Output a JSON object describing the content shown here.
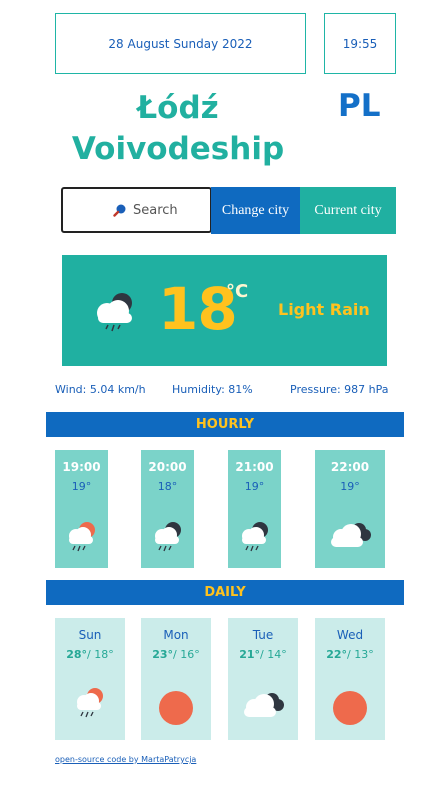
{
  "header": {
    "date": "28 August Sunday 2022",
    "time": "19:55"
  },
  "location": {
    "city_line1": "Łódź",
    "city_line2": "Voivodeship",
    "country": "PL"
  },
  "search": {
    "placeholder": "Search",
    "change_label": "Change city",
    "current_label": "Current city"
  },
  "current": {
    "temp": "18",
    "unit": "°C",
    "description": "Light Rain",
    "icon": "rain-cloud-icon"
  },
  "stats": {
    "wind": "Wind: 5.04 km/h",
    "humidity": "Humidity: 81%",
    "pressure": "Pressure: 987 hPa"
  },
  "hourly": {
    "title": "HOURLY",
    "items": [
      {
        "time": "19:00",
        "temp": "19°",
        "icon": "rain-cloud-icon"
      },
      {
        "time": "20:00",
        "temp": "18°",
        "icon": "rain-cloud-icon"
      },
      {
        "time": "21:00",
        "temp": "19°",
        "icon": "rain-cloud-icon"
      },
      {
        "time": "22:00",
        "temp": "19°",
        "icon": "cloudy-icon"
      }
    ]
  },
  "daily": {
    "title": "DAILY",
    "items": [
      {
        "day": "Sun",
        "high": "28°",
        "low": "18°",
        "icon": "sun-rain-icon"
      },
      {
        "day": "Mon",
        "high": "23°",
        "low": "16°",
        "icon": "sun-icon"
      },
      {
        "day": "Tue",
        "high": "21°",
        "low": "14°",
        "icon": "cloudy-icon"
      },
      {
        "day": "Wed",
        "high": "22°",
        "low": "13°",
        "icon": "sun-icon"
      }
    ]
  },
  "footer": {
    "link": "open-source code by MartaPatrycja"
  },
  "colors": {
    "teal": "#20b0a1",
    "blue": "#0f6ac0",
    "yellow": "#ffc21e",
    "sun": "#ee6a4c"
  }
}
